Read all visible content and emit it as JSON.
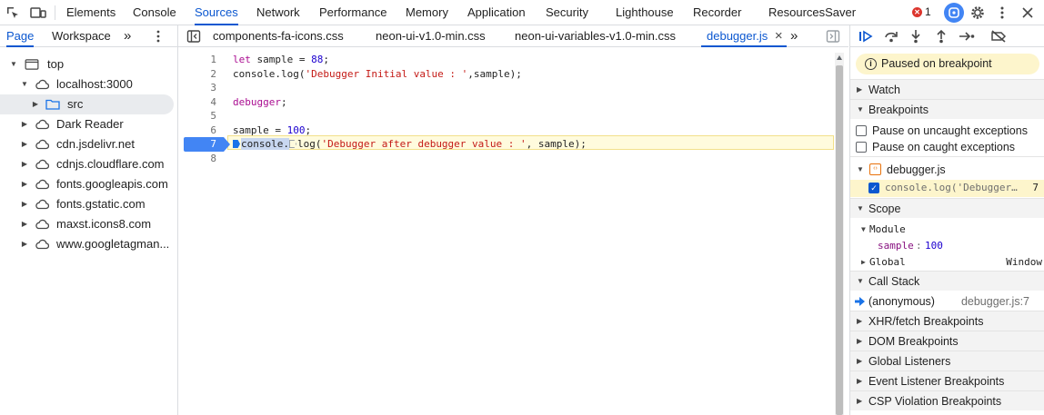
{
  "toolbar": {
    "tabs": [
      "Elements",
      "Console",
      "Sources",
      "Network",
      "Performance",
      "Memory",
      "Application",
      "Security",
      "Lighthouse",
      "Recorder",
      "ResourcesSaver"
    ],
    "active_tab": "Sources",
    "error_count": "1",
    "accent": "#0b57d0"
  },
  "navigator": {
    "tabs": [
      "Page",
      "Workspace"
    ],
    "more": "»",
    "tree": [
      {
        "label": "top",
        "icon": "frame-icon"
      },
      {
        "label": "localhost:3000",
        "icon": "cloud-icon"
      },
      {
        "label": "src",
        "icon": "folder-icon"
      },
      {
        "label": "Dark Reader",
        "icon": "cloud-icon"
      },
      {
        "label": "cdn.jsdelivr.net",
        "icon": "cloud-icon"
      },
      {
        "label": "cdnjs.cloudflare.com",
        "icon": "cloud-icon"
      },
      {
        "label": "fonts.googleapis.com",
        "icon": "cloud-icon"
      },
      {
        "label": "fonts.gstatic.com",
        "icon": "cloud-icon"
      },
      {
        "label": "maxst.icons8.com",
        "icon": "cloud-icon"
      },
      {
        "label": "www.googletagman..."
      }
    ]
  },
  "editor": {
    "file_tabs": [
      "components-fa-icons.css",
      "neon-ui-v1.0-min.css",
      "neon-ui-variables-v1.0-min.css",
      "debugger.js"
    ],
    "active_file": "debugger.js",
    "close_glyph": "×",
    "more": "»",
    "line_numbers": [
      "1",
      "2",
      "3",
      "4",
      "5",
      "6",
      "7",
      "8"
    ],
    "paused_line": "7",
    "lines": [
      [
        {
          "t": "let",
          "c": "kw"
        },
        {
          "t": " sample = ",
          "c": "var"
        },
        {
          "t": "88",
          "c": "num"
        },
        {
          "t": ";",
          "c": "var"
        }
      ],
      [
        {
          "t": "console.log(",
          "c": "var"
        },
        {
          "t": "'Debugger Initial value : '",
          "c": "str"
        },
        {
          "t": ",sample);",
          "c": "var"
        }
      ],
      [],
      [
        {
          "t": "debugger",
          "c": "kw"
        },
        {
          "t": ";",
          "c": "var"
        }
      ],
      [],
      [
        {
          "t": "sample = ",
          "c": "var"
        },
        {
          "t": "100",
          "c": "num"
        },
        {
          "t": ";",
          "c": "var"
        }
      ],
      [
        {
          "t": "console.",
          "c": "var"
        },
        {
          "t": "log(",
          "c": "var"
        },
        {
          "t": "'Debugger after debugger value : '",
          "c": "str"
        },
        {
          "t": ", sample);",
          "c": "var"
        }
      ],
      []
    ]
  },
  "debugger": {
    "paused_message": "Paused on breakpoint",
    "watch": "Watch",
    "breakpoints": "Breakpoints",
    "pause_uncaught": "Pause on uncaught exceptions",
    "pause_caught": "Pause on caught exceptions",
    "bp_file": "debugger.js",
    "bp_code": "console.log('Debugger…",
    "bp_line": "7",
    "scope": "Scope",
    "module": "Module",
    "var_name": "sample",
    "var_value": "100",
    "global": "Global",
    "global_value": "Window",
    "call_stack": "Call Stack",
    "frame_name": "(anonymous)",
    "frame_loc": "debugger.js:7",
    "xhr": "XHR/fetch Breakpoints",
    "dom": "DOM Breakpoints",
    "global_listeners": "Global Listeners",
    "event_listener": "Event Listener Breakpoints",
    "csp": "CSP Violation Breakpoints"
  }
}
